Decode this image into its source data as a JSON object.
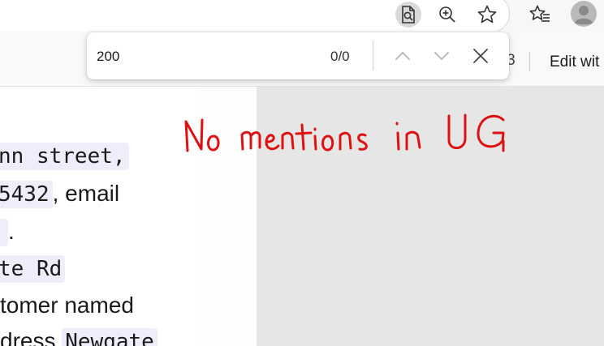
{
  "browser": {
    "toolbar_icons": [
      "read-aloud-icon",
      "zoom-in-icon",
      "favorite-star-icon",
      "favorites-list-icon",
      "profile-avatar-icon"
    ]
  },
  "doc_toolbar": {
    "edit_label": "Edit wit"
  },
  "find_bar": {
    "query": "200",
    "match_count": "0/0",
    "icons": [
      "previous-match-icon",
      "next-match-icon",
      "close-icon"
    ]
  },
  "document": {
    "lines": [
      {
        "code": "nn street,",
        "text": ""
      },
      {
        "code": "5432",
        "text": ", email"
      },
      {
        "code": "",
        "text": "."
      },
      {
        "code": "te Rd",
        "text": ""
      },
      {
        "code": "",
        "text": "tomer named"
      },
      {
        "prefix": "dress",
        "code": "Newgate",
        "text": ""
      }
    ]
  },
  "annotation": {
    "text": "No mentions in UG",
    "color": "#dd1111"
  },
  "colors": {
    "code_bg": "#eeeefb",
    "right_pane_bg": "#e6e6e6"
  }
}
